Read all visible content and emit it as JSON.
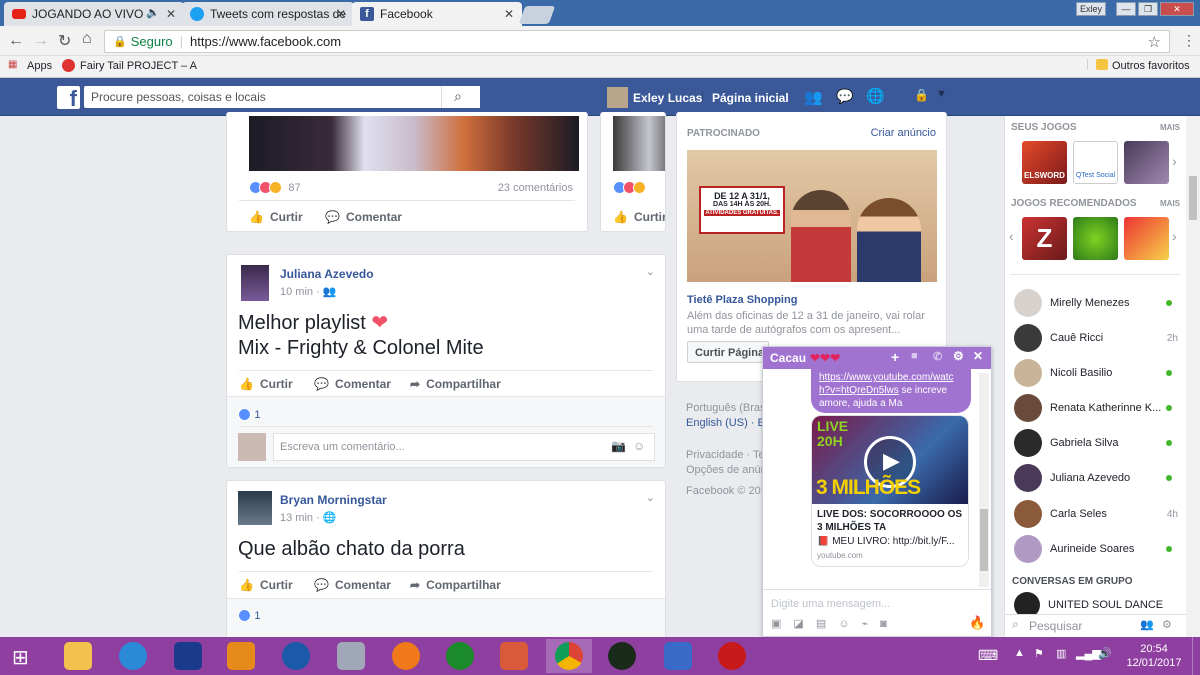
{
  "browser": {
    "tabs": [
      {
        "title": "JOGANDO AO VIVO -",
        "icon": "youtube-icon"
      },
      {
        "title": "Tweets com respostas de",
        "icon": "twitter-icon"
      },
      {
        "title": "Facebook",
        "icon": "facebook-icon"
      }
    ],
    "profile_name": "Exley",
    "secure_label": "Seguro",
    "url": "https://www.facebook.com",
    "bookmarks": [
      "Apps",
      "Fairy Tail PROJECT – A"
    ],
    "other_bookmarks": "Outros favoritos"
  },
  "header": {
    "logo": "f",
    "search_placeholder": "Procure pessoas, coisas e locais",
    "user_name": "Exley Lucas",
    "home_label": "Página inicial"
  },
  "feed": {
    "top_post": {
      "reaction_count": "87",
      "comments_count": "23 comentários",
      "like_label": "Curtir",
      "comment_label": "Comentar"
    },
    "side_post": {
      "like_label": "Curtir"
    },
    "posts": [
      {
        "author": "Juliana Azevedo",
        "time": "10 min",
        "text_line1": "Melhor playlist",
        "text_line2": "Mix - Frighty & Colonel Mite",
        "like_label": "Curtir",
        "comment_label": "Comentar",
        "share_label": "Compartilhar",
        "likes": "1",
        "comment_placeholder": "Escreva um comentário..."
      },
      {
        "author": "Bryan Morningstar",
        "time": "13 min",
        "text": "Que albão chato da porra",
        "like_label": "Curtir",
        "comment_label": "Comentar",
        "share_label": "Compartilhar",
        "likes": "1"
      }
    ]
  },
  "sponsored": {
    "heading": "PATROCINADO",
    "create_ad": "Criar anúncio",
    "ad_banner_line1": "DE 12 A 31/1,",
    "ad_banner_line2": "DAS 14H ÀS 20H.",
    "ad_banner_line3": "ATIVIDADES GRATUITAS.",
    "title": "Tietê Plaza Shopping",
    "description": "Além das oficinas de 12 a 31 de janeiro, vai rolar uma tarde de autógrafos com os apresent...",
    "like_page": "Curtir Página",
    "language_current": "Português (Bras",
    "language_alt": "English (US) · E",
    "footer_line1": "Privacidade · Te",
    "footer_line2": "Opções de anún",
    "copyright": "Facebook © 201"
  },
  "games": {
    "your_games": "SEUS JOGOS",
    "recommended": "JOGOS RECOMENDADOS",
    "more": "MAIS",
    "your_game_icons": [
      "ELSWORD",
      "QTest Social",
      ""
    ],
    "rec_game_icons": [
      "Z",
      "",
      ""
    ]
  },
  "contacts": [
    {
      "name": "Mirelly Menezes",
      "status": "online"
    },
    {
      "name": "Cauê Ricci",
      "status": "2h"
    },
    {
      "name": "Nicoli Basilio",
      "status": "online"
    },
    {
      "name": "Renata Katherinne K...",
      "status": "online"
    },
    {
      "name": "Gabriela Silva",
      "status": "online"
    },
    {
      "name": "Juliana Azevedo",
      "status": "online"
    },
    {
      "name": "Carla Seles",
      "status": "4h"
    },
    {
      "name": "Aurineide Soares",
      "status": "online"
    }
  ],
  "group_conversations": {
    "heading": "CONVERSAS EM GRUPO",
    "item": "UNITED SOUL DANCE",
    "search_placeholder": "Pesquisar"
  },
  "chat": {
    "name": "Cacau",
    "message_link": "https://www.youtube.com/watch?v=htQreDn5lws",
    "message_text": "se increve amore, ajuda a Ma",
    "preview_live": "LIVE",
    "preview_time": "20H",
    "preview_banner": "3 MILHÕES",
    "preview_title": "LIVE DOS: SOCORROOOO OS 3 MILHÕES TA",
    "preview_desc": "📕 MEU LIVRO: http://bit.ly/F...",
    "preview_domain": "youtube.com",
    "input_placeholder": "Digite uma mensagem..."
  },
  "taskbar": {
    "time": "20:54",
    "date": "12/01/2017"
  },
  "colors": {
    "fb_blue": "#3b5998",
    "chat_purple": "#a173d1",
    "taskbar": "#8e3fa0"
  }
}
